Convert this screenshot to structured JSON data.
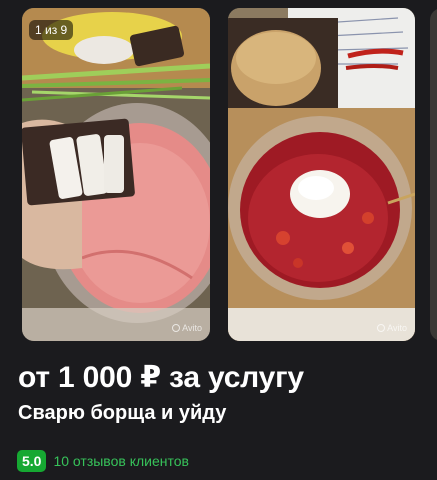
{
  "gallery": {
    "counter": "1 из 9",
    "watermark": "Avito",
    "photos": [
      {
        "icon": "photo-borscht-bread"
      },
      {
        "icon": "photo-borscht-sour-cream"
      }
    ]
  },
  "listing": {
    "price": "от 1 000 ₽ за услугу",
    "title": "Сварю борща и уйду",
    "rating": "5.0",
    "reviews": "10 отзывов клиентов"
  },
  "colors": {
    "background": "#1b1b1e",
    "rating_badge": "#16a832",
    "reviews_link": "#37c25a"
  }
}
